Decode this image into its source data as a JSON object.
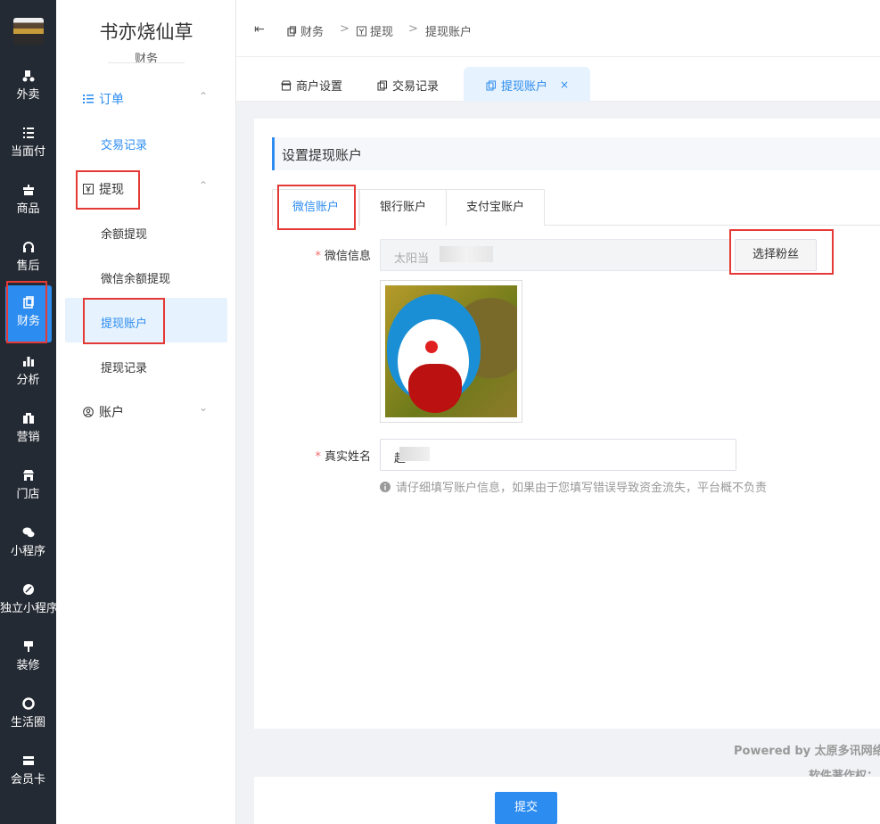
{
  "rail": {
    "items": [
      {
        "label": "外卖",
        "icon": "scooter-icon"
      },
      {
        "label": "当面付",
        "icon": "list-icon"
      },
      {
        "label": "商品",
        "icon": "gift-icon"
      },
      {
        "label": "售后",
        "icon": "headset-icon"
      },
      {
        "label": "财务",
        "icon": "finance-icon"
      },
      {
        "label": "分析",
        "icon": "bar-chart-icon"
      },
      {
        "label": "营销",
        "icon": "gift-box-icon"
      },
      {
        "label": "门店",
        "icon": "store-icon"
      },
      {
        "label": "小程序",
        "icon": "wechat-icon"
      },
      {
        "label": "独立小程序",
        "icon": "link-icon"
      },
      {
        "label": "装修",
        "icon": "paint-icon"
      },
      {
        "label": "生活圈",
        "icon": "circle-icon"
      },
      {
        "label": "会员卡",
        "icon": "card-icon"
      }
    ]
  },
  "menu": {
    "shop_name": "书亦烧仙草",
    "section": "财务",
    "group_order": "订单",
    "item_trade": "交易记录",
    "group_withdraw": "提现",
    "item_balance": "余额提现",
    "item_wx_balance": "微信余额提现",
    "item_account": "提现账户",
    "item_records": "提现记录",
    "group_account": "账户"
  },
  "header": {
    "crumb1": "财务",
    "crumb2": "提现",
    "crumb3": "提现账户",
    "sep": ">"
  },
  "tabs": {
    "tab1": "商户设置",
    "tab2": "交易记录",
    "tab3": "提现账户",
    "close": "×"
  },
  "form": {
    "title": "设置提现账户",
    "itab1": "微信账户",
    "itab2": "银行账户",
    "itab3": "支付宝账户",
    "wx_label": "微信信息",
    "wx_value": "太阳当",
    "pick_button": "选择粉丝",
    "name_label": "真实姓名",
    "name_value": "赵",
    "required": "*",
    "hint": "请仔细填写账户信息，如果由于您填写错误导致资金流失，平台概不负责"
  },
  "footer": {
    "powered": "Powered by 太原多讯网络",
    "copyright": "软件著作权：",
    "submit": "提交"
  },
  "colors": {
    "accent": "#2d8cf0",
    "rail_bg": "#242a33",
    "highlight": "#e53935"
  }
}
